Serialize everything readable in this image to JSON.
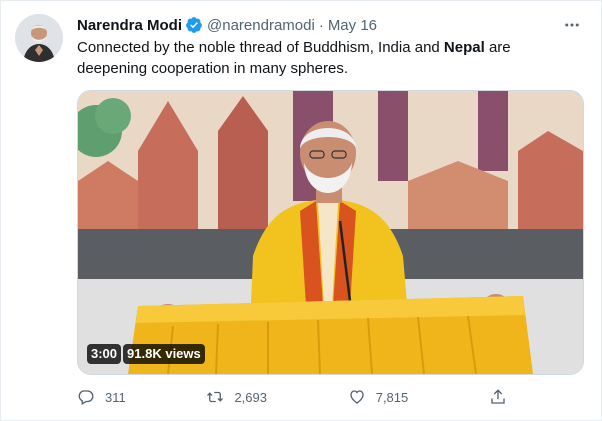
{
  "tweet": {
    "author_name": "Narendra Modi",
    "handle": "@narendramodi",
    "separator": "·",
    "date": "May 16",
    "text_parts": [
      "Connected by the noble thread of Buddhism, India and ",
      "Nepal",
      " are deepening cooperation in many spheres."
    ],
    "video": {
      "duration": "3:00",
      "views": "91.8K views"
    },
    "stats": {
      "replies": "311",
      "retweets": "2,693",
      "likes": "7,815"
    }
  },
  "icons": {
    "verified": "verified-badge-icon",
    "more": "more-options-icon",
    "reply": "reply-icon",
    "retweet": "retweet-icon",
    "like": "heart-icon",
    "share": "share-icon"
  },
  "colors": {
    "verified": "#1d9bf0",
    "secondary_text": "#536471",
    "primary_text": "#0f1419",
    "kurta": "#f2c21f",
    "stole": "#d9531e",
    "backdrop": "#c97160"
  }
}
